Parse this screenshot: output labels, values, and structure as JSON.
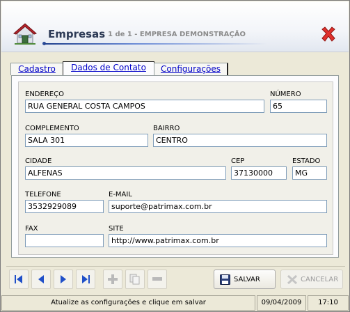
{
  "header": {
    "title": "Empresas",
    "subtitle": "1 de 1 - EMPRESA DEMONSTRAÇÃO",
    "icon": "house-icon",
    "close_icon": "close-x-icon"
  },
  "tabs": [
    {
      "label": "Cadastro",
      "active": false
    },
    {
      "label": "Dados de Contato",
      "active": true
    },
    {
      "label": "Configurações",
      "active": false
    }
  ],
  "form": {
    "endereco": {
      "label": "ENDEREÇO",
      "value": "RUA GENERAL COSTA CAMPOS"
    },
    "numero": {
      "label": "NÚMERO",
      "value": "65"
    },
    "complemento": {
      "label": "COMPLEMENTO",
      "value": "SALA 301"
    },
    "bairro": {
      "label": "BAIRRO",
      "value": "CENTRO"
    },
    "cidade": {
      "label": "CIDADE",
      "value": "ALFENAS"
    },
    "cep": {
      "label": "CEP",
      "value": "37130000"
    },
    "estado": {
      "label": "ESTADO",
      "value": "MG"
    },
    "telefone": {
      "label": "TELEFONE",
      "value": "3532929089"
    },
    "email": {
      "label": "E-MAIL",
      "value": "suporte@patrimax.com.br"
    },
    "fax": {
      "label": "FAX",
      "value": ""
    },
    "site": {
      "label": "SITE",
      "value": "http://www.patrimax.com.br"
    }
  },
  "toolbar": {
    "nav_icons": [
      "first-record-icon",
      "previous-record-icon",
      "next-record-icon",
      "last-record-icon"
    ],
    "edit_icons": [
      "add-icon",
      "copy-icon",
      "remove-icon"
    ],
    "save_label": "SALVAR",
    "cancel_label": "CANCELAR",
    "accent": "#1f4fc8"
  },
  "status": {
    "message": "Atualize as configurações e clique em salvar",
    "date": "09/04/2009",
    "time": "17:10"
  }
}
